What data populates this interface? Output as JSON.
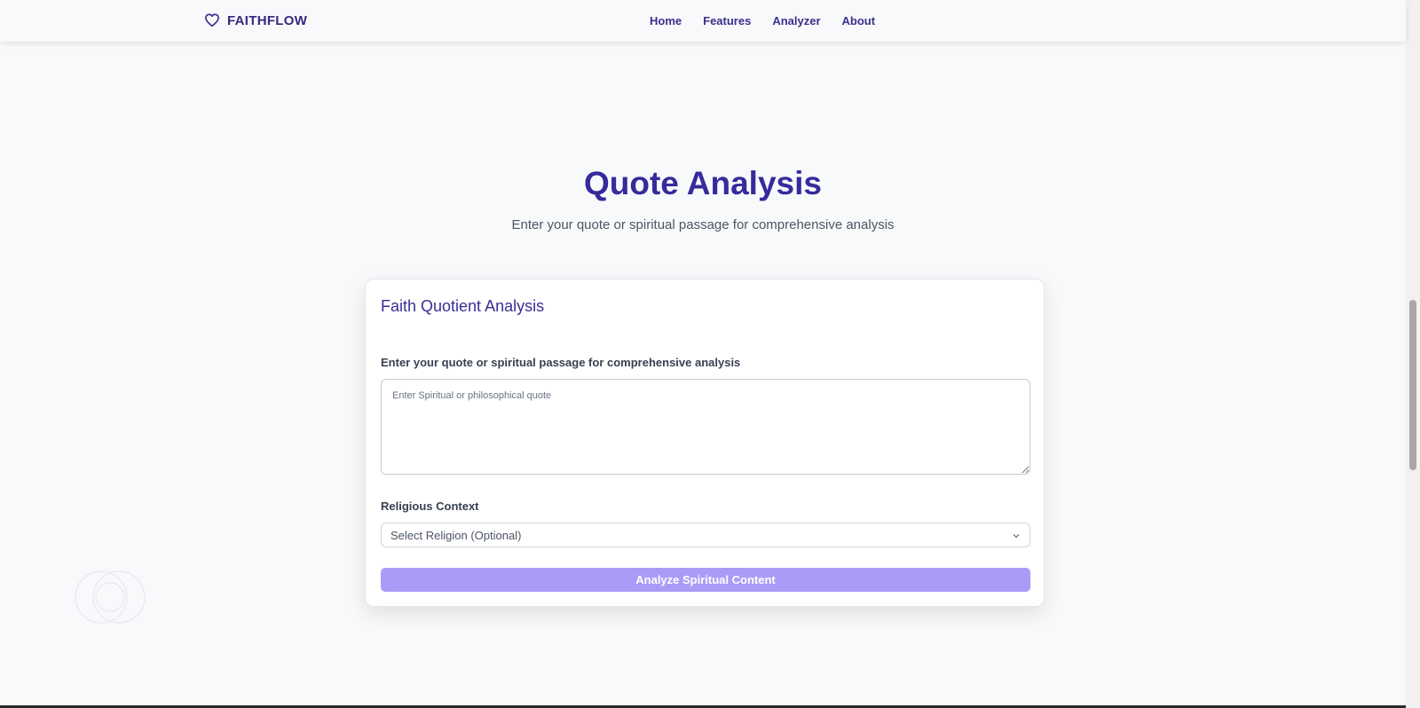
{
  "brand": {
    "name": "FAITHFLOW",
    "icon": "heart-icon"
  },
  "nav": {
    "items": [
      {
        "label": "Home"
      },
      {
        "label": "Features"
      },
      {
        "label": "Analyzer"
      },
      {
        "label": "About"
      }
    ]
  },
  "hero": {
    "title": "Quote Analysis",
    "subtitle": "Enter your quote or spiritual passage for comprehensive analysis"
  },
  "card": {
    "title": "Faith Quotient Analysis",
    "quote_label": "Enter your quote or spiritual passage for comprehensive analysis",
    "quote_placeholder": "Enter Spiritual or philosophical quote",
    "quote_value": "",
    "context_label": "Religious Context",
    "context_selected": "Select Religion (Optional)",
    "button_label": "Analyze Spiritual Content"
  },
  "colors": {
    "primary": "#372a9b",
    "button": "#a99cf7",
    "background": "#f8f9fb"
  }
}
